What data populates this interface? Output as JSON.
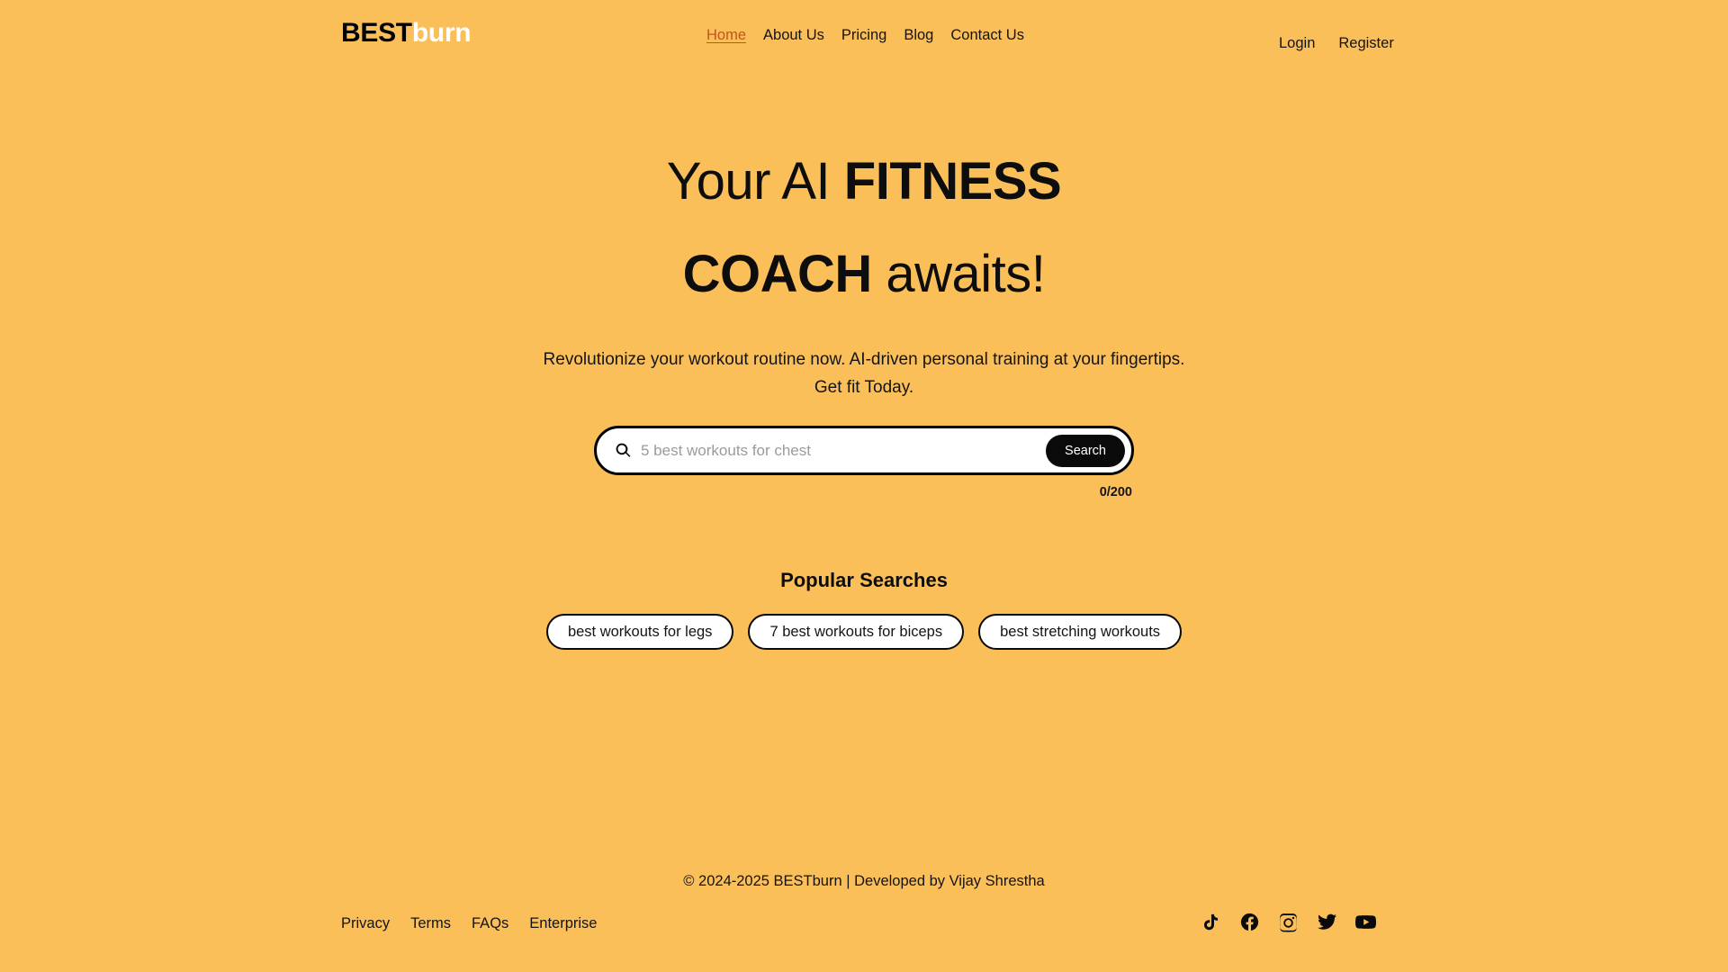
{
  "theme": {
    "background": "#fbbf5a",
    "text": "#141414",
    "accent": "#c2551a",
    "button_bg": "#0a0a0a",
    "button_text": "#ffffff",
    "card_bg": "#ffffff"
  },
  "header": {
    "logo": {
      "primary": "BEST",
      "secondary": "burn"
    },
    "nav": [
      {
        "label": "Home",
        "active": true
      },
      {
        "label": "About Us",
        "active": false
      },
      {
        "label": "Pricing",
        "active": false
      },
      {
        "label": "Blog",
        "active": false
      },
      {
        "label": "Contact Us",
        "active": false
      }
    ],
    "auth": [
      {
        "label": "Login"
      },
      {
        "label": "Register"
      }
    ]
  },
  "hero": {
    "title_line1_regular": "Your AI ",
    "title_line1_bold": "FITNESS",
    "title_line2_bold": "COACH",
    "title_line2_regular": " awaits!",
    "subtitle_line1": "Revolutionize your workout routine now. AI-driven personal training at your fingertips.",
    "subtitle_line2": "Get fit Today."
  },
  "search": {
    "icon": "search-icon",
    "value": "",
    "placeholder": "5 best workouts for chest",
    "button_label": "Search",
    "counter": "0/200"
  },
  "popular": {
    "title": "Popular Searches",
    "chips": [
      {
        "label": "best workouts for legs"
      },
      {
        "label": "7 best workouts for biceps"
      },
      {
        "label": "best stretching workouts"
      }
    ]
  },
  "footer": {
    "copyright": "© 2024-2025 BESTburn | Developed by Vijay Shrestha",
    "links": [
      {
        "label": "Privacy"
      },
      {
        "label": "Terms"
      },
      {
        "label": "FAQs"
      },
      {
        "label": "Enterprise"
      }
    ],
    "socials": [
      {
        "name": "tiktok-icon"
      },
      {
        "name": "facebook-icon"
      },
      {
        "name": "instagram-icon"
      },
      {
        "name": "twitter-icon"
      },
      {
        "name": "youtube-icon"
      }
    ]
  }
}
